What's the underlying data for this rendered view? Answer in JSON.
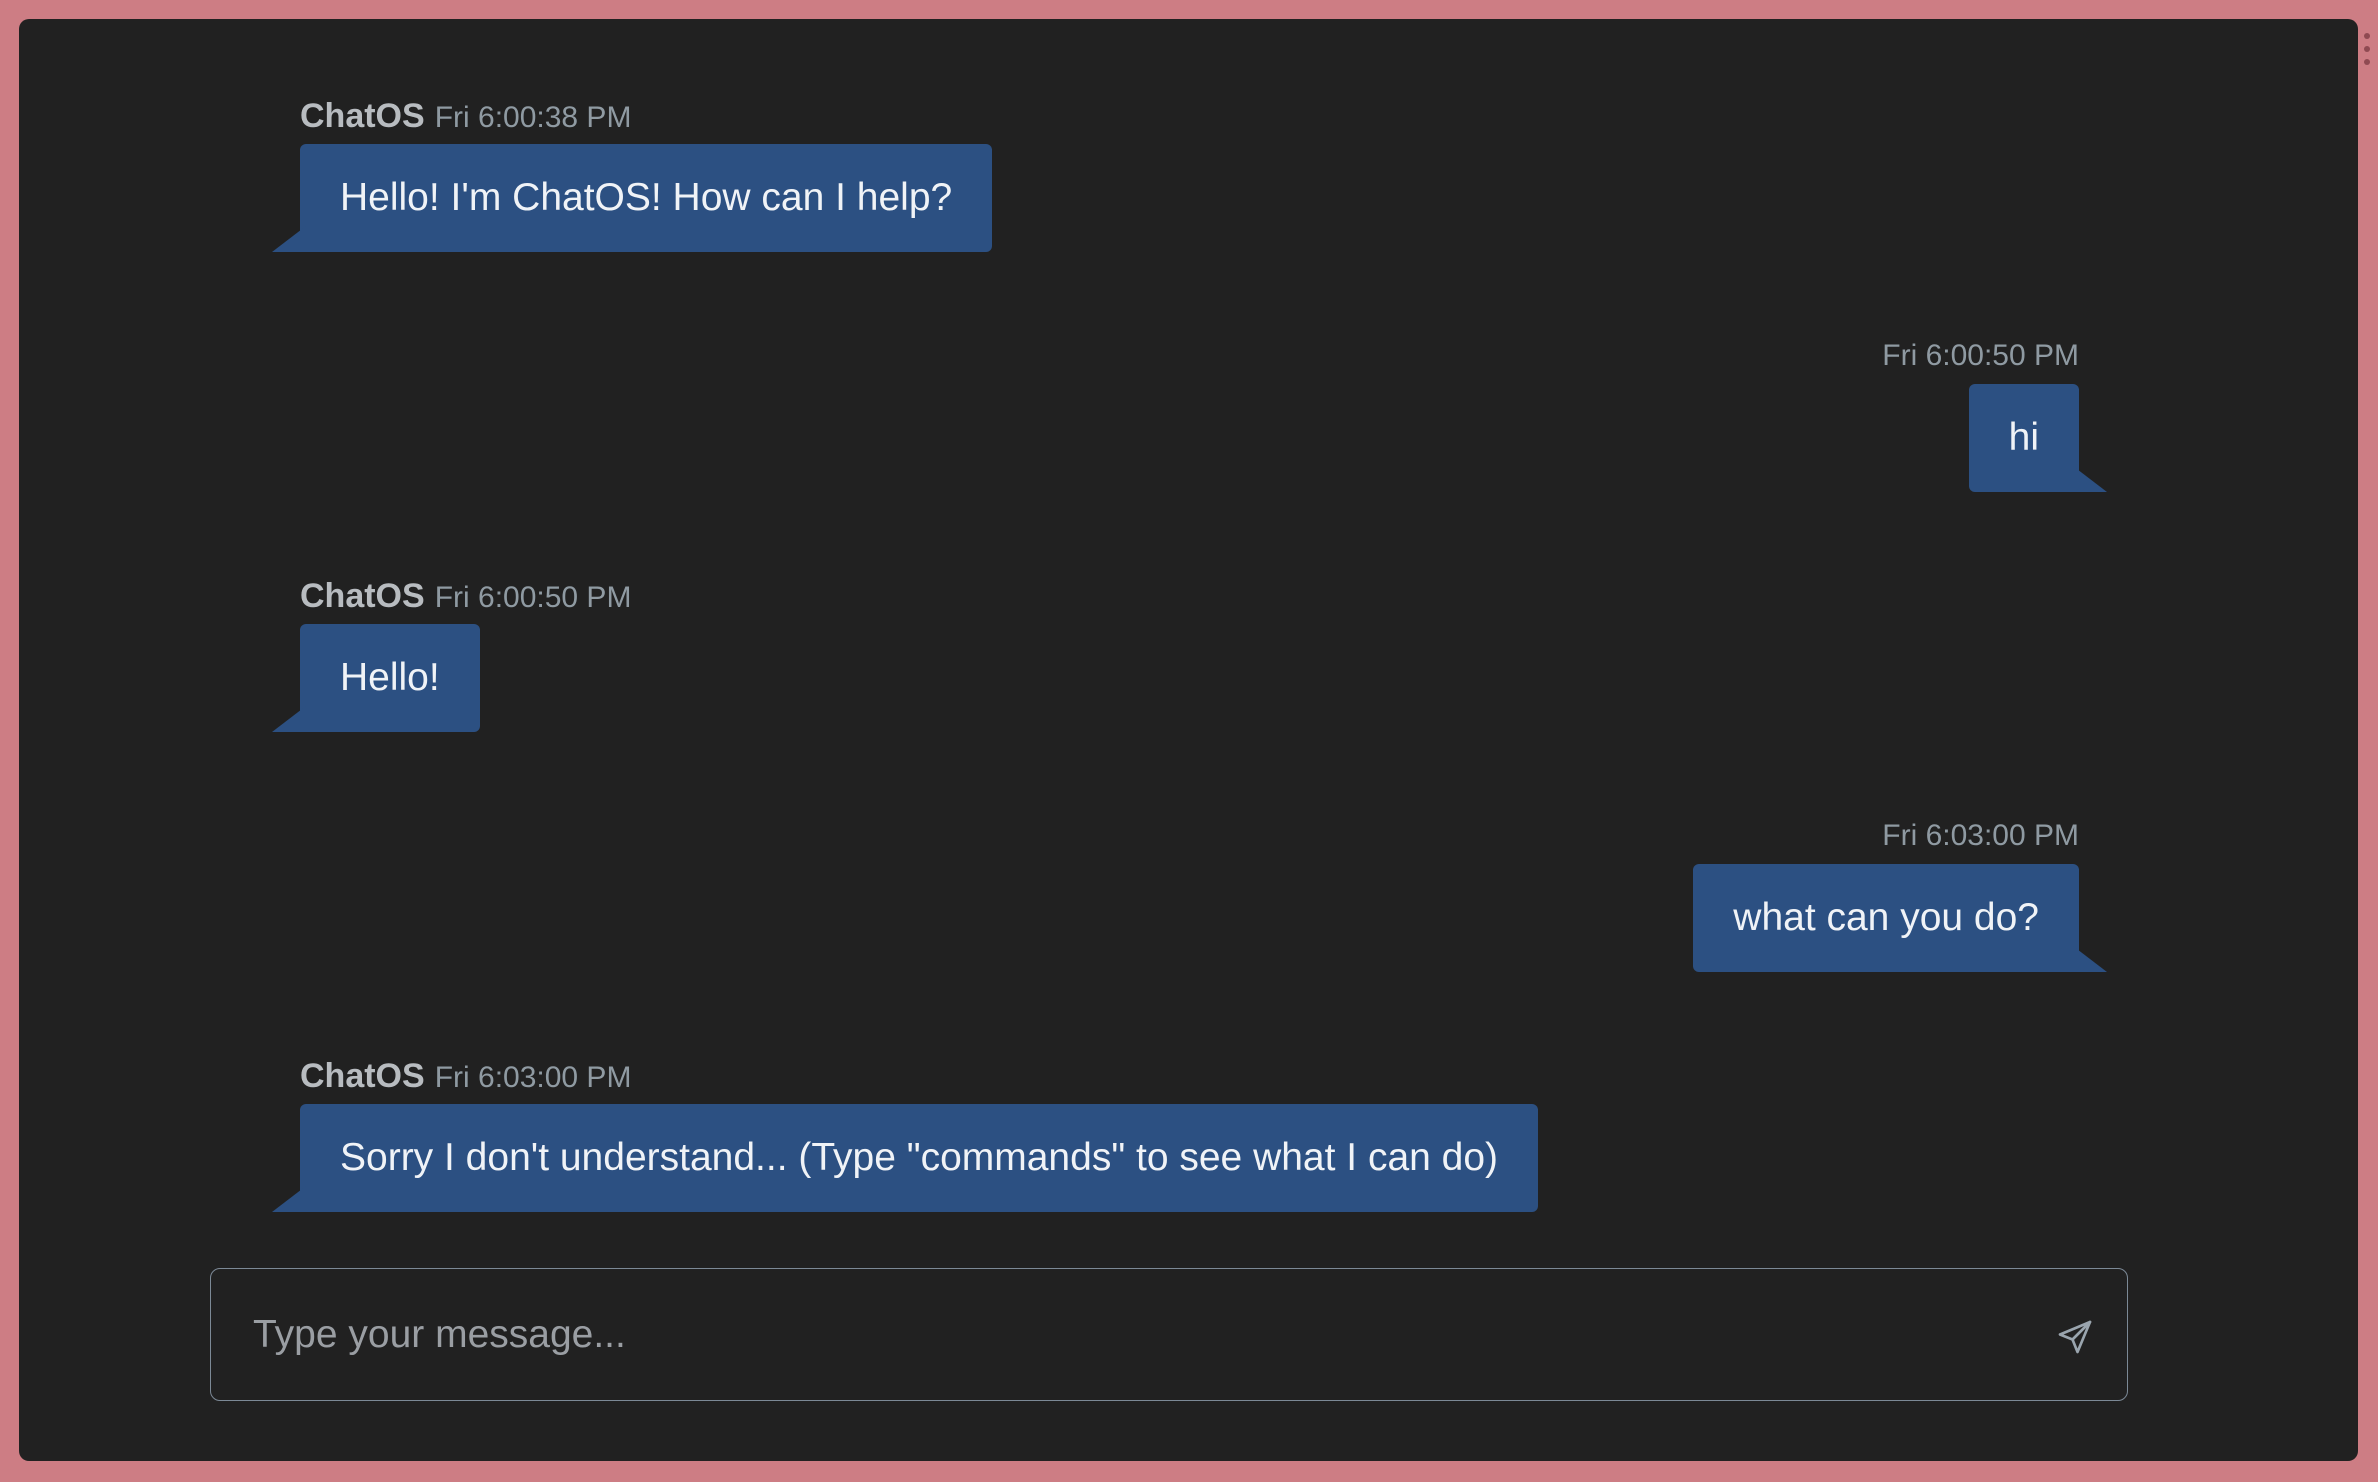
{
  "app": {
    "bot_name": "ChatOS"
  },
  "messages": [
    {
      "from": "bot",
      "sender": "ChatOS",
      "time": "Fri 6:00:38 PM",
      "text": "Hello! I'm ChatOS! How can I help?"
    },
    {
      "from": "user",
      "sender": "",
      "time": "Fri 6:00:50 PM",
      "text": "hi"
    },
    {
      "from": "bot",
      "sender": "ChatOS",
      "time": "Fri 6:00:50 PM",
      "text": "Hello!"
    },
    {
      "from": "user",
      "sender": "",
      "time": "Fri 6:03:00 PM",
      "text": "what can you do?"
    },
    {
      "from": "bot",
      "sender": "ChatOS",
      "time": "Fri 6:03:00 PM",
      "text": "Sorry I don't understand... (Type \"commands\" to see what I can do)"
    }
  ],
  "composer": {
    "value": "",
    "placeholder": "Type your message...",
    "send_icon": "send-icon"
  },
  "colors": {
    "frame": "#cd7d84",
    "background": "#212121",
    "bubble": "#2c5082",
    "meta_text": "#8f9aa2"
  }
}
